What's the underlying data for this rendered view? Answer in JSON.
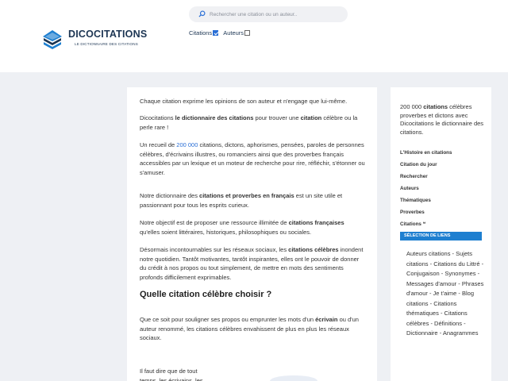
{
  "site": {
    "title": "DICOCITATIONS",
    "subtitle": "LE DICTIONNAIRE DES CITATIONS"
  },
  "search": {
    "placeholder": "Rechercher une citation ou un auteur..",
    "icon": "search-icon"
  },
  "filters": {
    "citations_label": "Citations",
    "citations_checked": true,
    "auteurs_label": "Auteurs",
    "auteurs_checked": false
  },
  "main": {
    "p1": "Chaque citation exprime les opinions de son auteur et n'engage que lui-même.",
    "p2": {
      "a": "Dicocitations ",
      "b": "le dictionnaire des citations",
      "c": " pour trouver une ",
      "d": "citation",
      "e": " célèbre ou la perle rare !"
    },
    "p3": {
      "a": "Un recueil de ",
      "b": "200 000",
      "c": " citations,  dictons,  aphorismes, pensées, paroles de personnes célèbres, d'écrivains illustres, ou romanciers ainsi que des  proverbes français accessibles par un lexique et un moteur de recherche pour rire, réfléchir, s'étonner ou s'amuser."
    },
    "p4": {
      "a": "Notre dictionnaire des ",
      "b": "citations et proverbes en français",
      "c": " est un site utile et passionnant pour tous les esprits curieux."
    },
    "p5": {
      "a": "Notre objectif est de proposer une ressource illimitée de ",
      "b": "citations françaises",
      "c": " qu'elles soient littéraires,  historiques, philosophiques ou sociales."
    },
    "p6": {
      "a": "Désormais incontournables sur les réseaux sociaux, les ",
      "b": "citations célèbres",
      "c": " inondent notre quotidien. Tantôt motivantes, tantôt inspirantes, elles ont le pouvoir de donner du crédit à nos propos ou tout simplement, de mettre en mots des sentiments profonds difficilement exprimables."
    },
    "heading": "Quelle citation célèbre choisir ?",
    "p7": {
      "a": "Que ce soit pour souligner ses propos ou emprunter les mots d'un ",
      "b": "écrivain",
      "c": " ou d'un auteur renommé, les citations célèbres envahissent de plus en plus les réseaux sociaux."
    },
    "p8": "Il faut dire que de tout temps, les écrivains, les"
  },
  "sidebar": {
    "intro": {
      "a": "200 000 ",
      "b": "citations",
      "c": " célèbres proverbes et dictons avec Dicocitations le dictionnaire des citations."
    },
    "nav": [
      "L'Histoire en citations",
      "Citation du jour",
      "Rechercher",
      "Auteurs",
      "Thématiques",
      "Proverbes",
      "Citations ❝"
    ],
    "selection_label": "SÉLECTION DE LIENS",
    "links": [
      "Auteurs citations",
      "Sujets citations",
      "Citations du Littré",
      "Conjugaison",
      "Synonymes",
      "Messages d'amour",
      "Phrases d'amour",
      "Je t'aime",
      "Blog citations",
      "Citations thématiques",
      "Citations célèbres",
      "Définitions",
      "Dictionnaire",
      "Anagrammes"
    ]
  }
}
